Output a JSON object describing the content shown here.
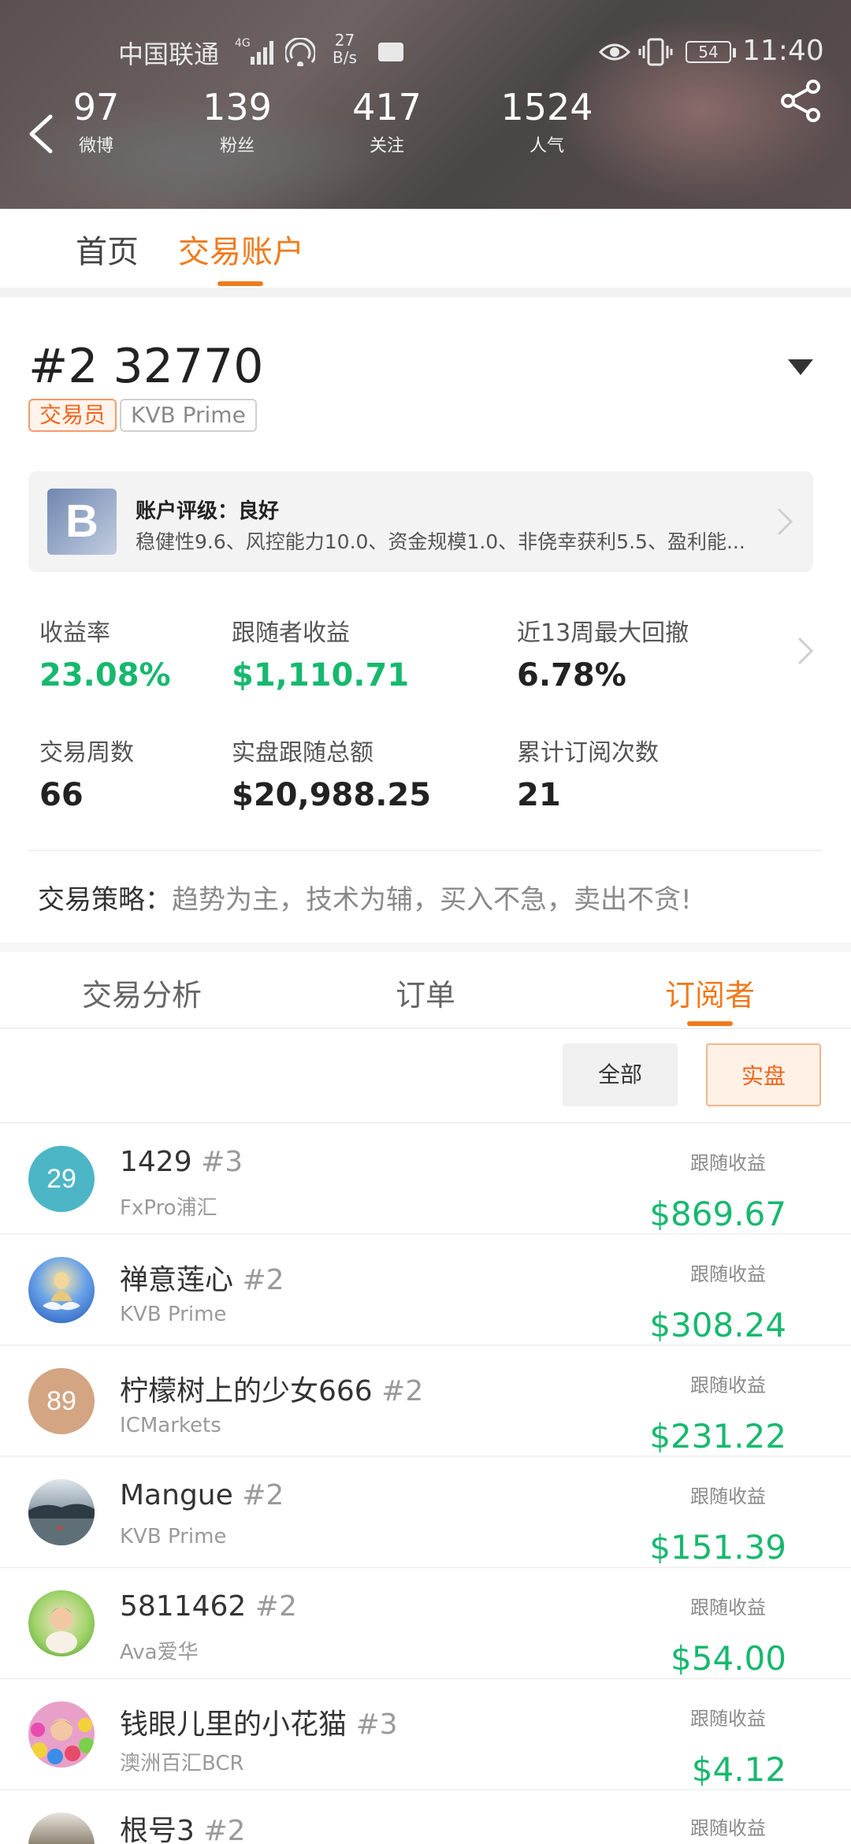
{
  "status_bar": {
    "carrier": "中国联通",
    "network": "4G",
    "signal_bars": 4,
    "net_speed_value": "27",
    "net_speed_unit": "B/s",
    "battery": "54",
    "time": "11:40"
  },
  "header": {
    "stats": [
      {
        "value": "97",
        "label": "微博"
      },
      {
        "value": "139",
        "label": "粉丝"
      },
      {
        "value": "417",
        "label": "关注"
      },
      {
        "value": "1524",
        "label": "人气"
      }
    ]
  },
  "top_tabs": [
    {
      "label": "首页",
      "active": false
    },
    {
      "label": "交易账户",
      "active": true
    }
  ],
  "account": {
    "id": "#2 32770",
    "tags": [
      "交易员",
      "KVB Prime"
    ],
    "rating": {
      "badge": "B",
      "title": "账户评级：良好",
      "description": "稳健性9.6、风控能力10.0、资金规模1.0、非侥幸获利5.5、盈利能..."
    },
    "metrics": [
      {
        "label": "收益率",
        "value": "23.08%",
        "highlight": true
      },
      {
        "label": "跟随者收益",
        "value": "$1,110.71",
        "highlight": true
      },
      {
        "label": "近13周最大回撤",
        "value": "6.78%",
        "highlight": false
      },
      {
        "label": "交易周数",
        "value": "66",
        "highlight": false
      },
      {
        "label": "实盘跟随总额",
        "value": "$20,988.25",
        "highlight": false
      },
      {
        "label": "累计订阅次数",
        "value": "21",
        "highlight": false
      }
    ],
    "strategy_label": "交易策略：",
    "strategy_value": "趋势为主，技术为辅，买入不急，卖出不贪!"
  },
  "detail_tabs": [
    {
      "label": "交易分析",
      "active": false
    },
    {
      "label": "订单",
      "active": false
    },
    {
      "label": "订阅者",
      "active": true
    }
  ],
  "filters": [
    {
      "label": "全部",
      "active": false
    },
    {
      "label": "实盘",
      "active": true
    }
  ],
  "subscribers": [
    {
      "avatar_text": "29",
      "name": "1429",
      "rank": "#3",
      "broker": "FxPro浦汇",
      "profit_label": "跟随收益",
      "profit": "$869.67"
    },
    {
      "avatar_text": "",
      "name": "禅意莲心",
      "rank": "#2",
      "broker": "KVB Prime",
      "profit_label": "跟随收益",
      "profit": "$308.24"
    },
    {
      "avatar_text": "89",
      "name": "柠檬树上的少女666",
      "rank": "#2",
      "broker": "ICMarkets",
      "profit_label": "跟随收益",
      "profit": "$231.22"
    },
    {
      "avatar_text": "",
      "name": "Mangue",
      "rank": "#2",
      "broker": "KVB Prime",
      "profit_label": "跟随收益",
      "profit": "$151.39"
    },
    {
      "avatar_text": "",
      "name": "5811462",
      "rank": "#2",
      "broker": "Ava爱华",
      "profit_label": "跟随收益",
      "profit": "$54.00"
    },
    {
      "avatar_text": "",
      "name": "钱眼儿里的小花猫",
      "rank": "#3",
      "broker": "澳洲百汇BCR",
      "profit_label": "跟随收益",
      "profit": "$4.12"
    },
    {
      "avatar_text": "",
      "name": "根号3",
      "rank": "#2",
      "broker": "",
      "profit_label": "跟随收益",
      "profit": ""
    }
  ],
  "colors": {
    "accent": "#f07a1c",
    "profit_green": "#17b86e"
  }
}
